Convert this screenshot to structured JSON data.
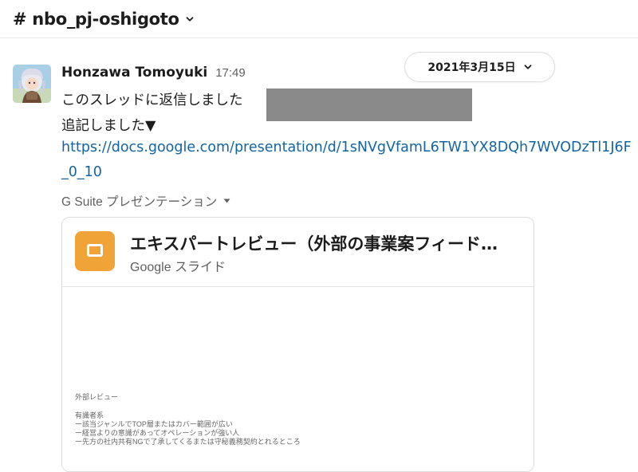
{
  "channel": {
    "name": "# nbo_pj-oshigoto",
    "chevron_icon": "chevron-down-icon"
  },
  "date_divider": {
    "label": "2021年3月15日",
    "chevron_icon": "chevron-down-icon"
  },
  "message": {
    "sender": "Honzawa Tomoyuki",
    "time": "17:49",
    "line1": "このスレッドに返信しました",
    "line2": "追記しました▼",
    "url_line1": "https://docs.google.com/presentation/d/1sNVgVfamL6TW1YX8DQh7WVODzTl1J6F",
    "url_line2": "_0_10"
  },
  "attachment": {
    "source": "G Suite プレゼンテーション",
    "title": "エキスパートレビュー（外部の事業案フィード…",
    "subtitle": "Google スライド",
    "preview_lines": [
      "外部レビュー",
      "有識者系",
      "ー該当ジャンルでTOP層またはカバー範囲が広い",
      "ー経営よりの意識があってオペレーションが強い人",
      "ー先方の社内共有NGで了承してくるまたは守秘義務契約とれるところ"
    ]
  },
  "colors": {
    "link": "#1264a3",
    "slides_icon": "#f0a437",
    "redaction": "#8a8a8a",
    "muted_text": "#616061"
  }
}
